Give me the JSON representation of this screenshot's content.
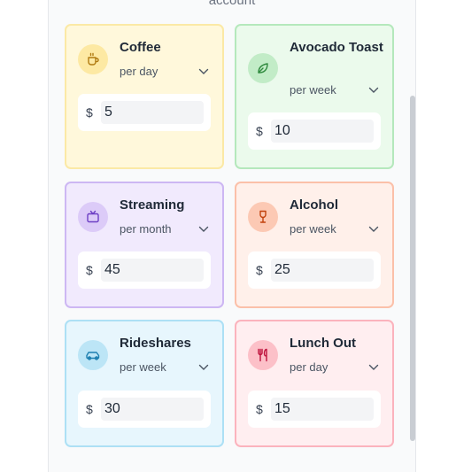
{
  "header": {
    "subtitle": "account"
  },
  "currency_symbol": "$",
  "cards": [
    {
      "id": "coffee",
      "name": "Coffee",
      "frequency": "per day",
      "amount": "5",
      "icon": "coffee-cup-icon",
      "accent": "#fde9a3"
    },
    {
      "id": "avocado",
      "name": "Avocado Toast",
      "frequency": "per week",
      "amount": "10",
      "icon": "leaf-icon",
      "accent": "#c2ecc7"
    },
    {
      "id": "streaming",
      "name": "Streaming",
      "frequency": "per month",
      "amount": "45",
      "icon": "tv-icon",
      "accent": "#dccbf8"
    },
    {
      "id": "alcohol",
      "name": "Alcohol",
      "frequency": "per week",
      "amount": "25",
      "icon": "wine-glass-icon",
      "accent": "#fcc9b4"
    },
    {
      "id": "rideshares",
      "name": "Rideshares",
      "frequency": "per week",
      "amount": "30",
      "icon": "car-icon",
      "accent": "#bce5f6"
    },
    {
      "id": "lunch",
      "name": "Lunch Out",
      "frequency": "per day",
      "amount": "15",
      "icon": "utensils-icon",
      "accent": "#fcc0c8"
    }
  ]
}
